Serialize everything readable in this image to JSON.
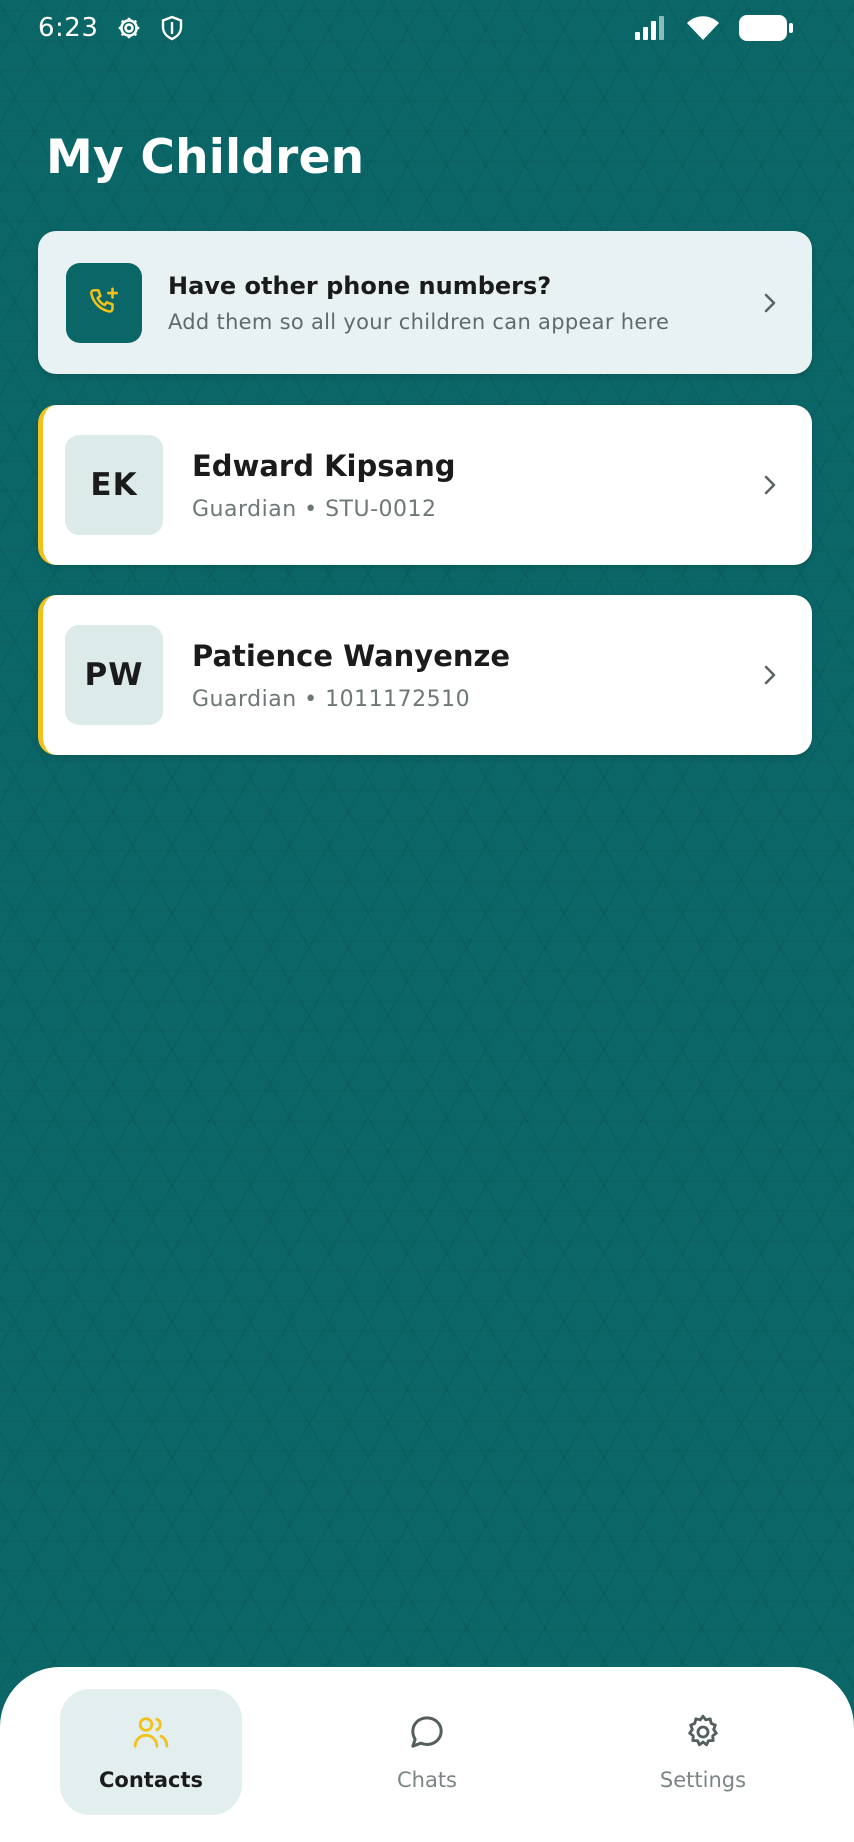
{
  "status_bar": {
    "time": "6:23",
    "left_icons": [
      "gear-icon",
      "shield-icon"
    ],
    "right_icons": [
      "cellular-signal-icon",
      "wifi-icon",
      "battery-icon"
    ]
  },
  "page": {
    "title": "My Children"
  },
  "banner": {
    "icon": "phone-add-icon",
    "title": "Have other phone numbers?",
    "subtitle": "Add them so all your children can appear here"
  },
  "children": [
    {
      "initials": "EK",
      "name": "Edward Kipsang",
      "meta": "Guardian • STU-0012"
    },
    {
      "initials": "PW",
      "name": "Patience Wanyenze",
      "meta": "Guardian • 1011172510"
    }
  ],
  "nav": {
    "items": [
      {
        "label": "Contacts",
        "icon": "contacts-icon",
        "active": true
      },
      {
        "label": "Chats",
        "icon": "chat-bubble-icon",
        "active": false
      },
      {
        "label": "Settings",
        "icon": "gear-icon",
        "active": false
      }
    ]
  },
  "colors": {
    "background": "#0b6667",
    "accent": "#f2c21b",
    "card": "#ffffff",
    "banner": "#e9f2f2",
    "avatar_bg": "#dcebea"
  }
}
